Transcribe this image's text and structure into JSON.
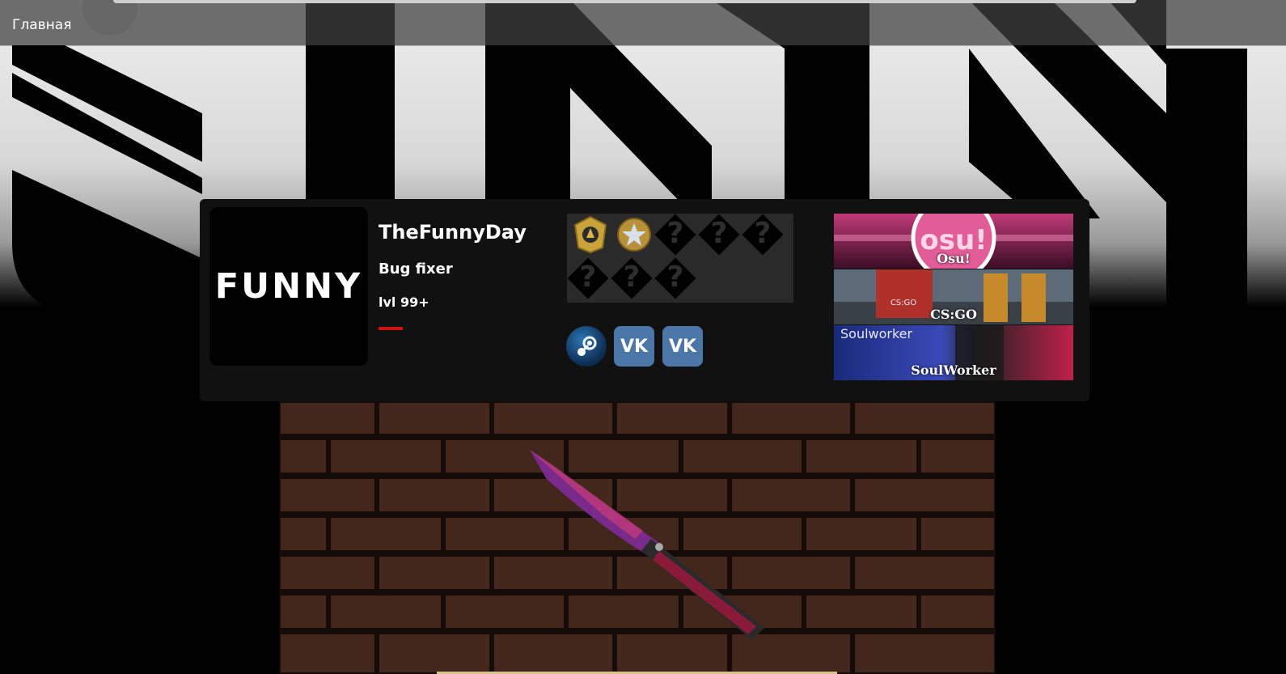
{
  "nav": {
    "home_label": "Главная"
  },
  "profile": {
    "avatar_text": "FUNNY",
    "username": "TheFunnyDay",
    "role": "Bug fixer",
    "level": "lvl 99+",
    "level_progress": 0.05
  },
  "medals": {
    "earned": [
      "gold-star-medal-1",
      "gold-star-medal-2"
    ],
    "locked_placeholder": "?",
    "locked_count": 6
  },
  "social": [
    {
      "name": "steam",
      "label": ""
    },
    {
      "name": "vk",
      "label": "VK"
    },
    {
      "name": "vk",
      "label": "VK"
    }
  ],
  "games": [
    {
      "label": "Osu!",
      "banner_text": "osu!"
    },
    {
      "label": "CS:GO",
      "banner_text": "CS:GO"
    },
    {
      "label": "SoulWorker",
      "banner_text": "Soulworker"
    }
  ],
  "colors": {
    "accent": "#d21010",
    "card": "#111111",
    "vk": "#4a76a8",
    "osu": "#e0508a"
  }
}
